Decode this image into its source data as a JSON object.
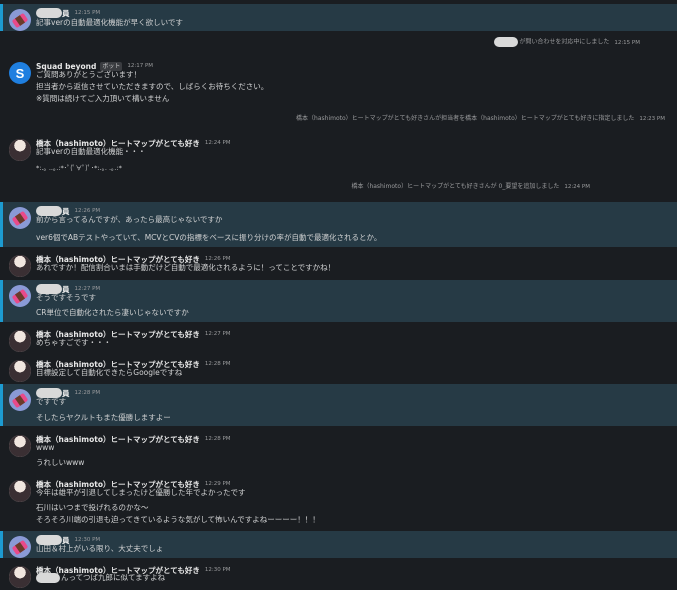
{
  "colors": {
    "background": "#1a1d21",
    "highlight": "#263a45",
    "accent": "#1d9bd1"
  },
  "users": {
    "hashimoto": "橋本（hashimoto）ヒートマップがとても好き",
    "squad": "Squad beyond",
    "bot_badge": "ボット",
    "masked_suffix": "員"
  },
  "messages": [
    {
      "time": "12:15 PM",
      "lines": [
        "記事verの自動最適化機能が早く欲しいです"
      ]
    },
    {
      "time": "12:17 PM",
      "lines": [
        "ご質問ありがとうございます！",
        "担当者から返信させていただきますので、しばらくお待ちください。",
        "※質問は続けてご入力頂いて構いません"
      ]
    },
    {
      "time": "12:24 PM",
      "lines": [
        "記事verの自動最適化機能・・・",
        "*:.｡ ..｡.:*･ﾟ(ﾟ∀ﾟ)ﾟ･*:.｡. .｡.:*"
      ]
    },
    {
      "time": "12:26 PM",
      "lines": [
        "前から言ってるんですが、あったら最高じゃないですか",
        "ver6個でABテストやっていて、MCVとCVの指標をベースに振り分けの率が自動で最適化されるとか。"
      ]
    },
    {
      "time": "12:26 PM",
      "lines": [
        "あれですか！配信割合いまは手動だけど自動で最適化されるように！ってことですかね！"
      ]
    },
    {
      "time": "12:27 PM",
      "lines": [
        "そうですそうです",
        "CR単位で自動化されたら凄いじゃないですか"
      ]
    },
    {
      "time": "12:27 PM",
      "lines": [
        "めちゃすごです・・・"
      ]
    },
    {
      "time": "12:28 PM",
      "lines": [
        "目標設定して自動化できたらGoogleですね"
      ]
    },
    {
      "time": "12:28 PM",
      "lines": [
        "ですです",
        "そしたらヤクルトもまた優勝しますよー"
      ]
    },
    {
      "time": "12:28 PM",
      "lines": [
        "www",
        "うれしいwww"
      ]
    },
    {
      "time": "12:29 PM",
      "lines": [
        "今年は雄平が引退してしまったけど優勝した年でよかったです",
        "石川はいつまで投げれるのかな〜",
        "そろそろ川端の引退も迫ってきているような気がして怖いんですよねーーーー！！！"
      ]
    },
    {
      "time": "12:30 PM",
      "lines": [
        "山田＆村上がいる限り、大丈夫でしょ"
      ]
    },
    {
      "time": "12:30 PM",
      "lines": [
        "んってつば九郎に似てますよね"
      ]
    }
  ],
  "system": [
    {
      "text": "が問い合わせを対応中にしました",
      "time": "12:15 PM"
    },
    {
      "text": "橋本（hashimoto）ヒートマップがとても好きさんが担当者を橋本（hashimoto）ヒートマップがとても好きに指定しました",
      "time": "12:23 PM"
    },
    {
      "text": "橋本（hashimoto）ヒートマップがとても好きさんが 0_要望を追加しました",
      "time": "12:24 PM"
    }
  ]
}
